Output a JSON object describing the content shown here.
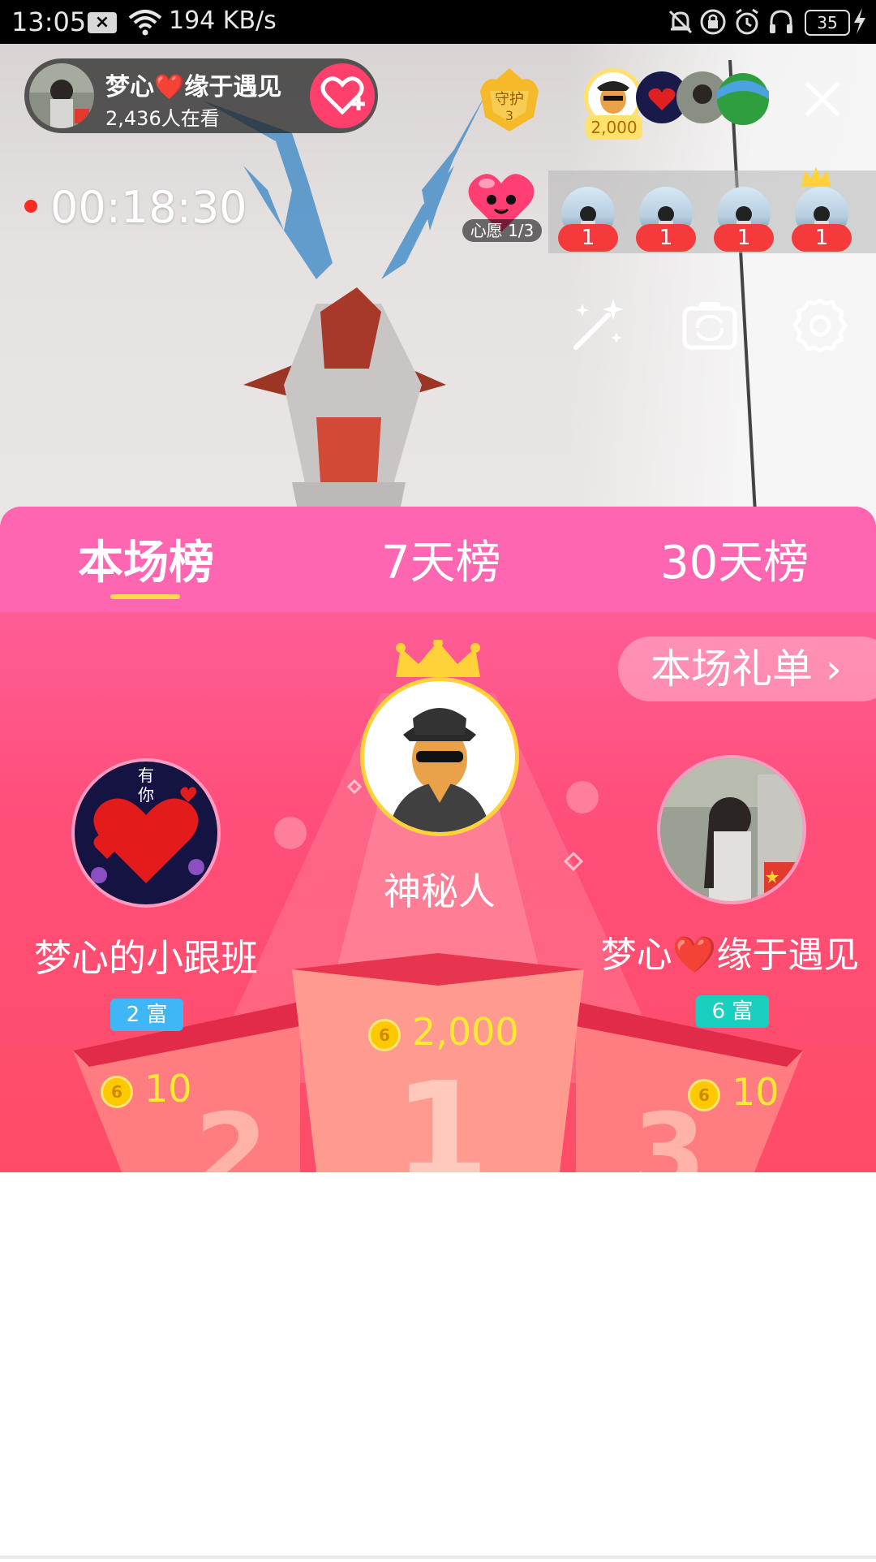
{
  "status_bar": {
    "time": "13:05",
    "speed": "194 KB/s",
    "battery": "35",
    "icons": [
      "notification-x-icon",
      "wifi-icon",
      "mute-bell-icon",
      "rotation-lock-icon",
      "alarm-icon",
      "headphones-icon",
      "battery-icon",
      "charging-bolt-icon"
    ]
  },
  "live": {
    "host_name": "梦心❤️缘于遇见",
    "viewers": "2,436人在看",
    "guard_count": "3",
    "guard_label": "守护",
    "top_contribution": "2,000",
    "timer": "00:18:30",
    "wish": {
      "label": "心愿 1/3"
    },
    "viewer_counts": [
      "1",
      "1",
      "1",
      "1"
    ]
  },
  "leaderboard": {
    "tabs": [
      "本场榜",
      "7天榜",
      "30天榜"
    ],
    "active_tab": 0,
    "gift_list_label": "本场礼单 ›",
    "first": {
      "name": "神秘人",
      "coins": "2,000"
    },
    "second": {
      "name": "梦心的小跟班",
      "level": "2 富",
      "coins": "10"
    },
    "third": {
      "name": "梦心❤️缘于遇见",
      "level": "6 富",
      "coins": "10"
    },
    "podium_numbers": [
      "2",
      "1",
      "3"
    ]
  },
  "colors": {
    "accent_pink": "#ff66b1",
    "level2_badge": "#3fb6f5",
    "level6_badge": "#19cfc0",
    "coin_text": "#ffea30"
  }
}
